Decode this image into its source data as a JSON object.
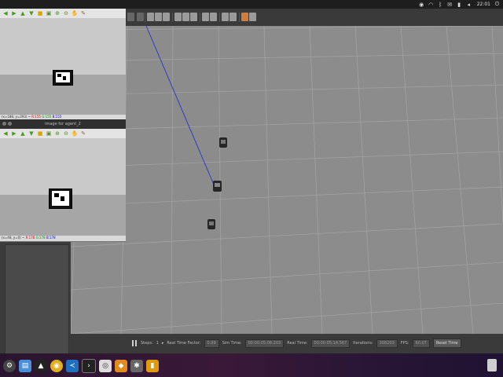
{
  "system_bar": {
    "clock": "22:01",
    "icons": [
      "camera-icon",
      "wifi-icon",
      "bluetooth-icon",
      "mail-icon",
      "battery-icon",
      "volume-icon",
      "power-icon"
    ]
  },
  "image_window_1": {
    "status": {
      "coords": "(x=188, y=393)",
      "sep": " ~ ",
      "r": "R:155",
      "g": "G:155",
      "b": "B:155"
    }
  },
  "image_window_2": {
    "title": "image for agent_2",
    "status": {
      "coords": "(x=48, y=0)",
      "sep": " ~ ",
      "r": "R:178",
      "g": "G:178",
      "b": "B:178"
    }
  },
  "image_toolbar_icons": [
    "arrow-left-icon",
    "arrow-right-icon",
    "arrow-up-icon",
    "arrow-down-icon",
    "save-icon",
    "image-icon",
    "zoom-in-icon",
    "zoom-out-icon",
    "hand-icon",
    "settings-icon"
  ],
  "gazebo_status": {
    "steps_label": "Steps:",
    "steps_value": "1",
    "rtf_label": "Real Time Factor:",
    "rtf_value": "0.99",
    "sim_time_label": "Sim Time:",
    "sim_time_value": "00:00:05:08.203",
    "real_time_label": "Real Time:",
    "real_time_value": "00:00:05:14.567",
    "iterations_label": "Iterations:",
    "iterations_value": "308203",
    "fps_label": "FPS:",
    "fps_value": "60.07",
    "reset_label": "Reset Time"
  },
  "dock_apps": [
    "settings-gear-icon",
    "files-icon",
    "inkscape-icon",
    "chrome-icon",
    "vscode-icon",
    "terminal-icon",
    "camera-app-icon",
    "gazebo-icon",
    "system-icon",
    "usb-icon"
  ],
  "colors": {
    "grid_bg": "#8c8c8c",
    "grid_line": "#a6a6a6",
    "ray": "#3030c8",
    "robot": "#222222"
  }
}
